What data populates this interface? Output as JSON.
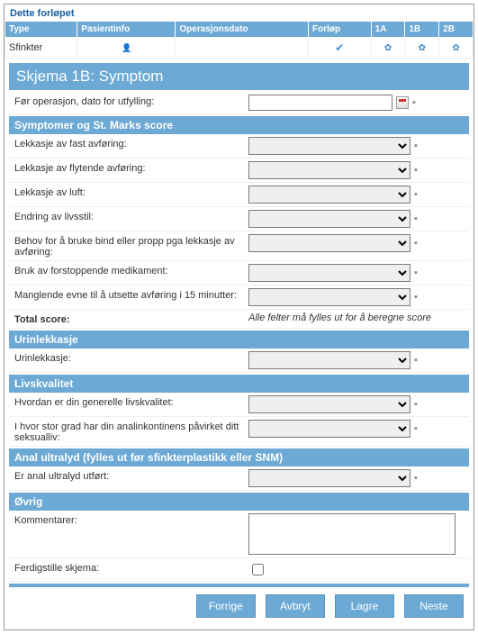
{
  "top": {
    "label": "Dette forløpet",
    "headers": [
      "Type",
      "Pasientinfo",
      "Operasjonsdato",
      "Forløp",
      "1A",
      "1B",
      "2B"
    ],
    "row": {
      "type": "Sfinkter"
    }
  },
  "form": {
    "title": "Skjema 1B: Symptom",
    "date_label": "Før operasjon, dato for utfylling:",
    "sec_symptoms": "Symptomer og St. Marks score",
    "q1": "Lekkasje av fast avføring:",
    "q2": "Lekkasje av flytende avføring:",
    "q3": "Lekkasje av luft:",
    "q4": "Endring av livsstil:",
    "q5": "Behov for å bruke bind eller propp pga lekkasje av avføring:",
    "q6": "Bruk av forstoppende medikament:",
    "q7": "Manglende evne til å utsette avføring i 15 minutter:",
    "total_label": "Total score:",
    "total_note": "Alle felter må fylles ut for å beregne score",
    "sec_urin": "Urinlekkasje",
    "q8": "Urinlekkasje:",
    "sec_livs": "Livskvalitet",
    "q9": "Hvordan er din generelle livskvalitet:",
    "q10": "I hvor stor grad har din analinkontinens påvirket ditt seksualliv:",
    "sec_anal": "Anal ultralyd (fylles ut før sfinkterplastikk eller SNM)",
    "q11": "Er anal ultralyd utført:",
    "sec_ovrig": "Øvrig",
    "q12": "Kommentarer:",
    "q13": "Ferdigstille skjema:"
  },
  "buttons": {
    "prev": "Forrige",
    "cancel": "Avbryt",
    "save": "Lagre",
    "next": "Neste"
  }
}
